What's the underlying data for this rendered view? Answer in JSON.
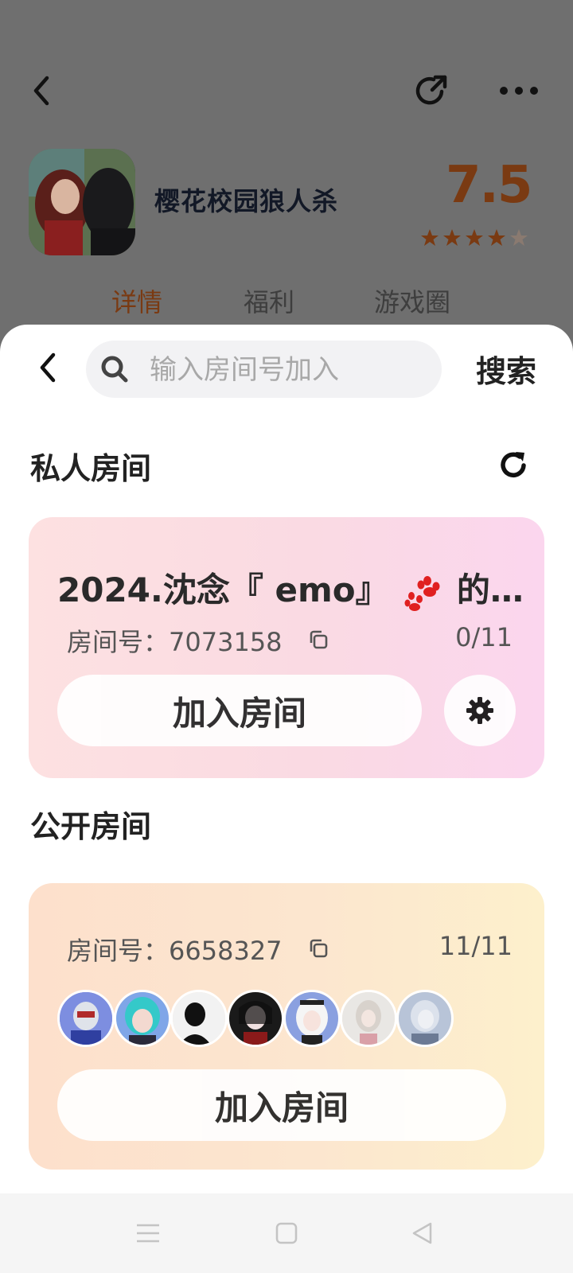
{
  "background": {
    "game_title": "樱花校园狼人杀",
    "score": "7.5",
    "rating_stars": 4,
    "rating_max": 5,
    "tabs": [
      {
        "label": "详情",
        "active": true
      },
      {
        "label": "福利",
        "active": false
      },
      {
        "label": "游戏圈",
        "active": false
      }
    ],
    "icons": [
      "back-icon",
      "share-icon",
      "more-icon"
    ],
    "accent_color": "#7a3a12"
  },
  "search": {
    "placeholder": "输入房间号加入",
    "value": "",
    "button_label": "搜索"
  },
  "private_section": {
    "title": "私人房间",
    "room": {
      "name_prefix": "2024.沈念『 emo』",
      "name_suffix": "的…",
      "id_label": "房间号：",
      "id": "7073158",
      "count": "0/11",
      "join_label": "加入房间"
    }
  },
  "public_section": {
    "title": "公开房间",
    "room": {
      "id_label": "房间号：",
      "id": "6658327",
      "count": "11/11",
      "join_label": "加入房间",
      "avatar_count": 7
    }
  },
  "system_nav": [
    "menu-key",
    "home-key",
    "back-key"
  ]
}
